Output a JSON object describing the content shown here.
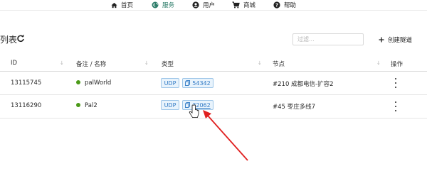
{
  "nav": {
    "items": [
      {
        "label": "首页",
        "icon": "home-icon"
      },
      {
        "label": "服务",
        "icon": "globe-icon"
      },
      {
        "label": "用户",
        "icon": "user-icon"
      },
      {
        "label": "商城",
        "icon": "cart-icon"
      },
      {
        "label": "帮助",
        "icon": "help-icon"
      }
    ],
    "active": "服务"
  },
  "page": {
    "title": "列表",
    "filter_placeholder": "过滤...",
    "create_label": "创建隧道"
  },
  "table": {
    "columns": [
      "ID",
      "备注 / 名称",
      "类型",
      "节点",
      "操作"
    ],
    "rows": [
      {
        "id": "13115745",
        "name": "palWorld",
        "protocol": "UDP",
        "port": "54342",
        "node": "#210 成都电信-扩容2"
      },
      {
        "id": "13116290",
        "name": "Pal2",
        "protocol": "UDP",
        "port": "32062",
        "node": "#45 枣庄多线7"
      }
    ]
  },
  "colors": {
    "accent": "#2e7d6a",
    "status_online": "#4b9a18",
    "chip_text": "#2f78c4",
    "annotation_arrow": "#e02020"
  }
}
